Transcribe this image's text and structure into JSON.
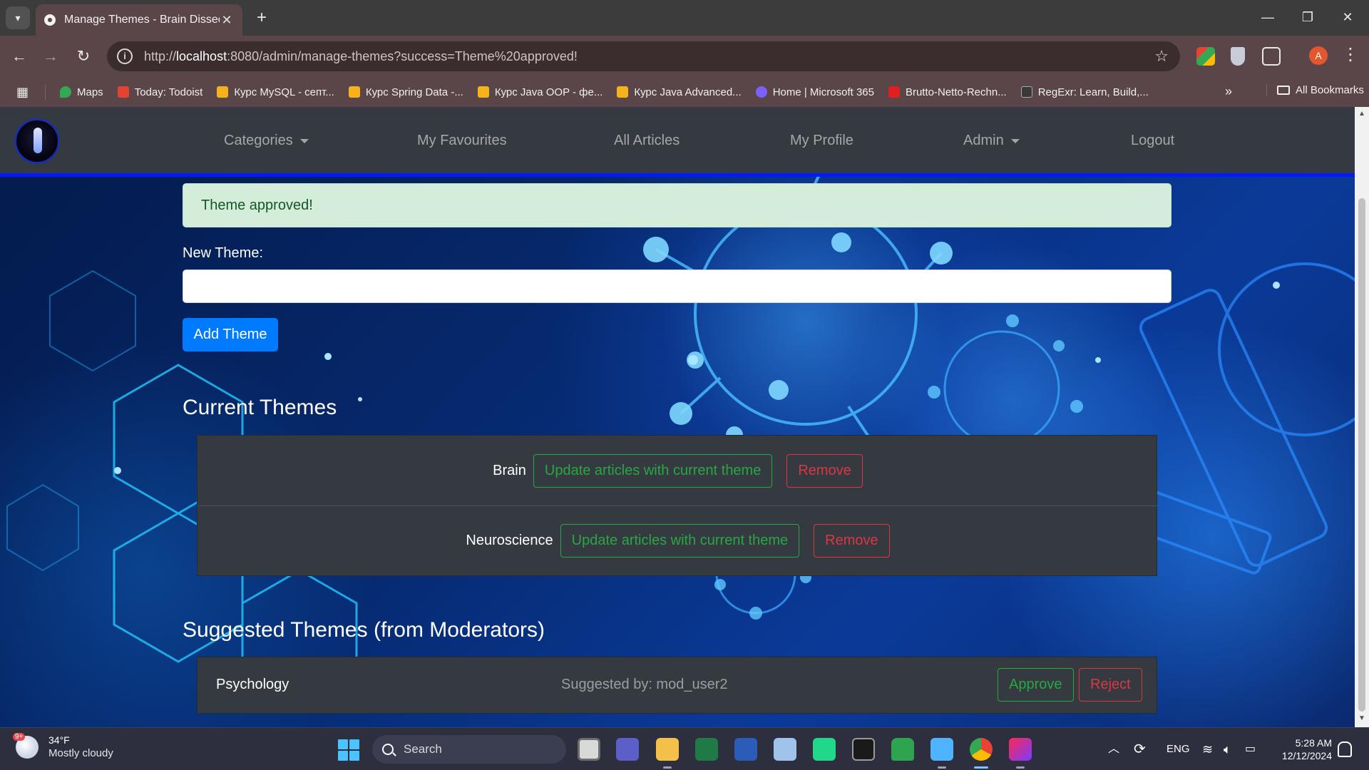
{
  "browser": {
    "tab_title": "Manage Themes - Brain Dissect",
    "url_prefix": "http://",
    "url_host": "localhost",
    "url_rest": ":8080/admin/manage-themes?success=Theme%20approved!",
    "avatar_letter": "A",
    "bookmarks": [
      {
        "label": "Maps",
        "color": "#34a853"
      },
      {
        "label": "Today: Todoist",
        "color": "#e44332"
      },
      {
        "label": "Курс MySQL - септ...",
        "color": "#f5b21b"
      },
      {
        "label": "Курс Spring Data -...",
        "color": "#f5b21b"
      },
      {
        "label": "Курс Java OOP - фе...",
        "color": "#f5b21b"
      },
      {
        "label": "Курс Java Advanced...",
        "color": "#f5b21b"
      },
      {
        "label": "Home | Microsoft 365",
        "color": "#7b61ff"
      },
      {
        "label": "Brutto-Netto-Rechn...",
        "color": "#e02020"
      },
      {
        "label": "RegExr: Learn, Build,...",
        "color": "#3a3a3a"
      }
    ],
    "all_bookmarks": "All Bookmarks"
  },
  "nav": {
    "categories": "Categories",
    "favourites": "My Favourites",
    "articles": "All Articles",
    "profile": "My Profile",
    "admin": "Admin",
    "logout": "Logout"
  },
  "alert": "Theme approved!",
  "form": {
    "label": "New Theme:",
    "value": "",
    "button": "Add Theme"
  },
  "current": {
    "heading": "Current Themes",
    "update_label": "Update articles with current theme",
    "remove_label": "Remove",
    "items": [
      "Brain",
      "Neuroscience"
    ]
  },
  "suggested": {
    "heading": "Suggested Themes (from Moderators)",
    "items": [
      {
        "name": "Psychology",
        "by": "Suggested by: mod_user2",
        "approve": "Approve",
        "reject": "Reject"
      }
    ]
  },
  "taskbar": {
    "weather_badge": "9+",
    "temp": "34°F",
    "condition": "Mostly cloudy",
    "search": "Search",
    "lang": "ENG",
    "time": "5:28 AM",
    "date": "12/12/2024"
  }
}
